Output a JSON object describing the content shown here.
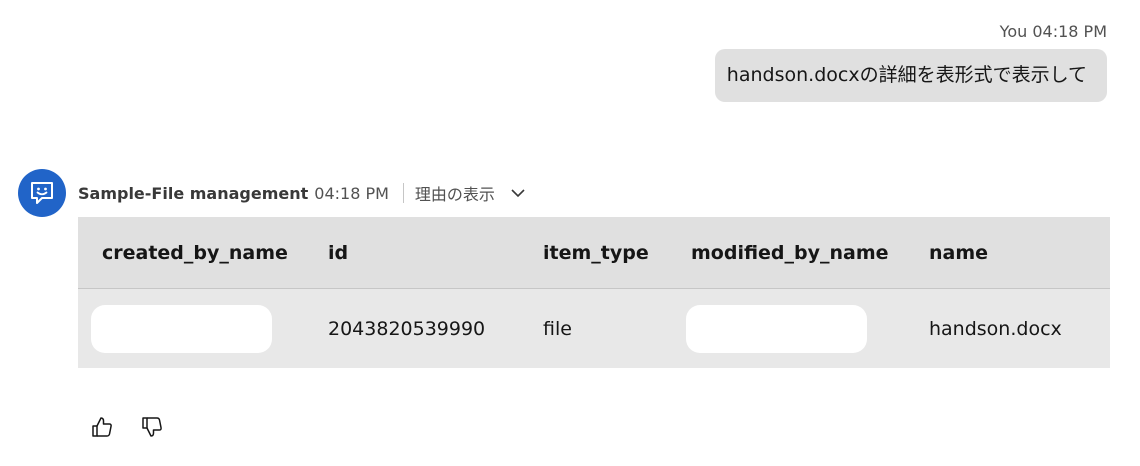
{
  "user_message": {
    "sender": "You",
    "time": "04:18 PM",
    "text": "handson.docxの詳細を表形式で表示して"
  },
  "bot_message": {
    "name": "Sample-File management",
    "time": "04:18 PM",
    "reason_label": "理由の表示",
    "avatar_icon": "chat-bot-icon",
    "avatar_color": "#2164c8"
  },
  "table": {
    "columns": [
      "created_by_name",
      "id",
      "item_type",
      "modified_by_name",
      "name"
    ],
    "rows": [
      {
        "created_by_name": "",
        "id": "2043820539990",
        "item_type": "file",
        "modified_by_name": "",
        "name": "handson.docx"
      }
    ]
  },
  "feedback": {
    "like_icon": "thumbs-up-icon",
    "dislike_icon": "thumbs-down-icon"
  }
}
